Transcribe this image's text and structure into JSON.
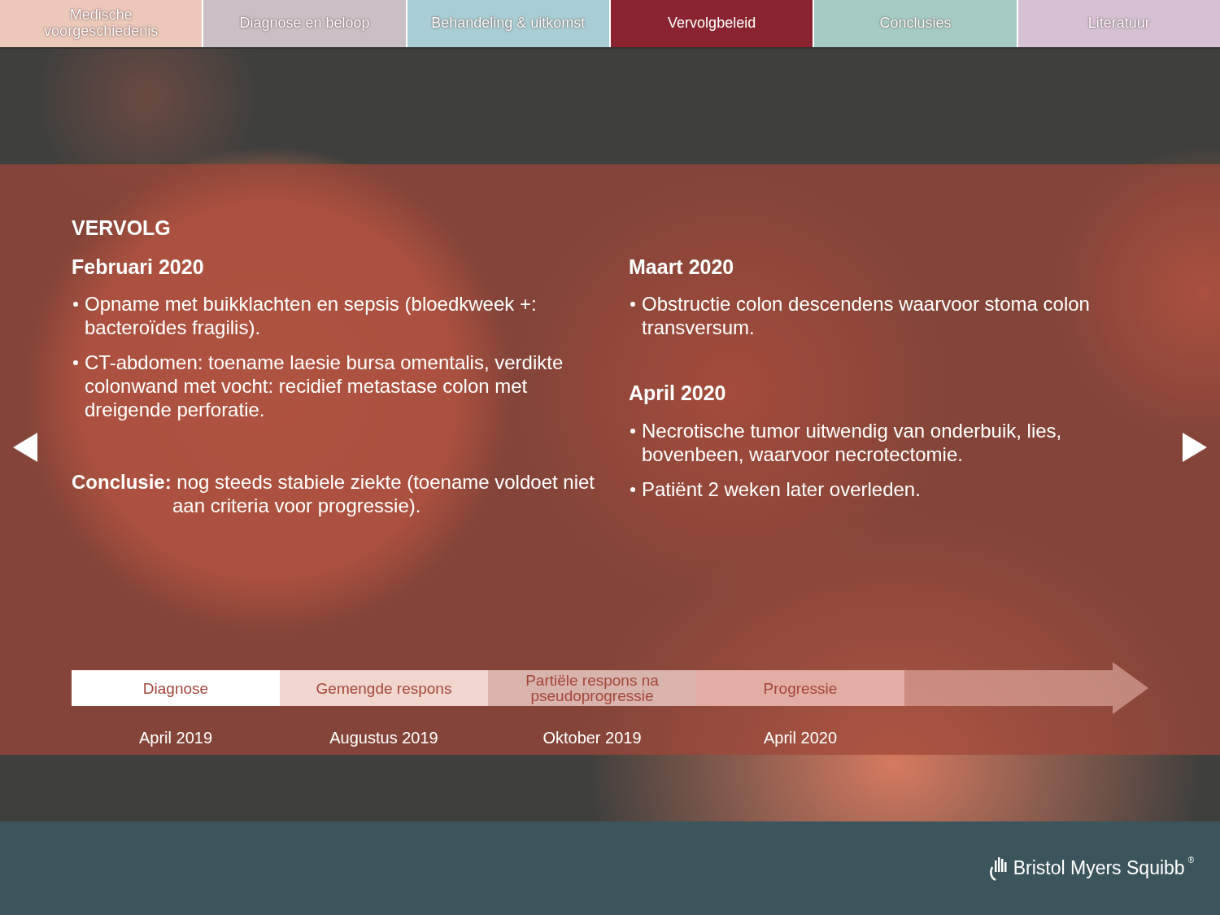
{
  "tabs": [
    {
      "label": "Medische voorgeschiedenis",
      "selected": false,
      "color": "#ecc8bb"
    },
    {
      "label": "Diagnose en beloop",
      "selected": false,
      "color": "#c9bfc5"
    },
    {
      "label": "Behandeling & uitkomst",
      "selected": false,
      "color": "#a9cdd4"
    },
    {
      "label": "Vervolgbeleid",
      "selected": true,
      "color": "#8a2430"
    },
    {
      "label": "Conclusies",
      "selected": false,
      "color": "#a6cbc5"
    },
    {
      "label": "Literatuur",
      "selected": false,
      "color": "#d6c0d3"
    }
  ],
  "panel": {
    "title": "VERVOLG",
    "left": [
      {
        "heading": "Februari 2020",
        "bullets": [
          "Opname met buikklachten en sepsis (bloedkweek +: bacteroïdes fragilis).",
          "CT-abdomen: toename laesie bursa omentalis, verdikte colonwand met vocht: recidief metastase colon met dreigende perforatie."
        ]
      }
    ],
    "conclusion": "**Conclusie:** nog steeds stabiele ziekte (toename voldoet niet aan criteria voor progressie).",
    "right": [
      {
        "heading": "Maart 2020",
        "bullets": [
          "Obstructie colon descendens waarvoor stoma colon transversum."
        ]
      },
      {
        "heading": "April 2020",
        "bullets": [
          "Necrotische tumor uitwendig van onderbuik, lies, bovenbeen, waarvoor necrotectomie.",
          "Patiënt 2 weken later overleden."
        ]
      }
    ],
    "timeline": [
      {
        "label": "Diagnose",
        "date": "April 2019",
        "color": "#ffffff"
      },
      {
        "label": "Gemengde respons",
        "date": "Augustus 2019",
        "color": "#f1d6d0"
      },
      {
        "label": "Partiële respons na pseudoprogressie",
        "date": "Oktober 2019",
        "color": "#d9b3ad"
      },
      {
        "label": "Progressie",
        "date": "April 2020",
        "color": "#e2aea4"
      }
    ]
  },
  "footer": {
    "brand": "Bristol Myers Squibb",
    "trademark": "®"
  }
}
